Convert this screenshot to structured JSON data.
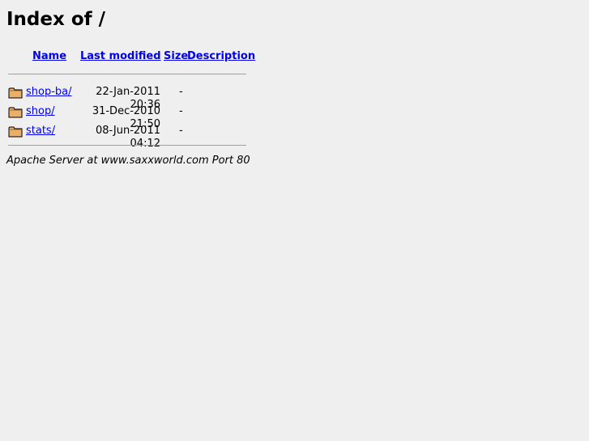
{
  "title": "Index of /",
  "headers": {
    "name": "Name",
    "last_modified": "Last modified",
    "size": "Size",
    "description": "Description"
  },
  "rows": [
    {
      "name": "shop-ba/",
      "modified": "22-Jan-2011 20:36",
      "size": "-",
      "description": "",
      "icon": "folder-icon"
    },
    {
      "name": "shop/",
      "modified": "31-Dec-2010 21:50",
      "size": "-",
      "description": "",
      "icon": "folder-icon"
    },
    {
      "name": "stats/",
      "modified": "08-Jun-2011 04:12",
      "size": "-",
      "description": "",
      "icon": "folder-icon"
    }
  ],
  "footer": "Apache Server at www.saxxworld.com Port 80",
  "colors": {
    "background": "#efefef",
    "link": "#0000ee",
    "folder_fill": "#e8b06a",
    "folder_stroke": "#000000"
  }
}
